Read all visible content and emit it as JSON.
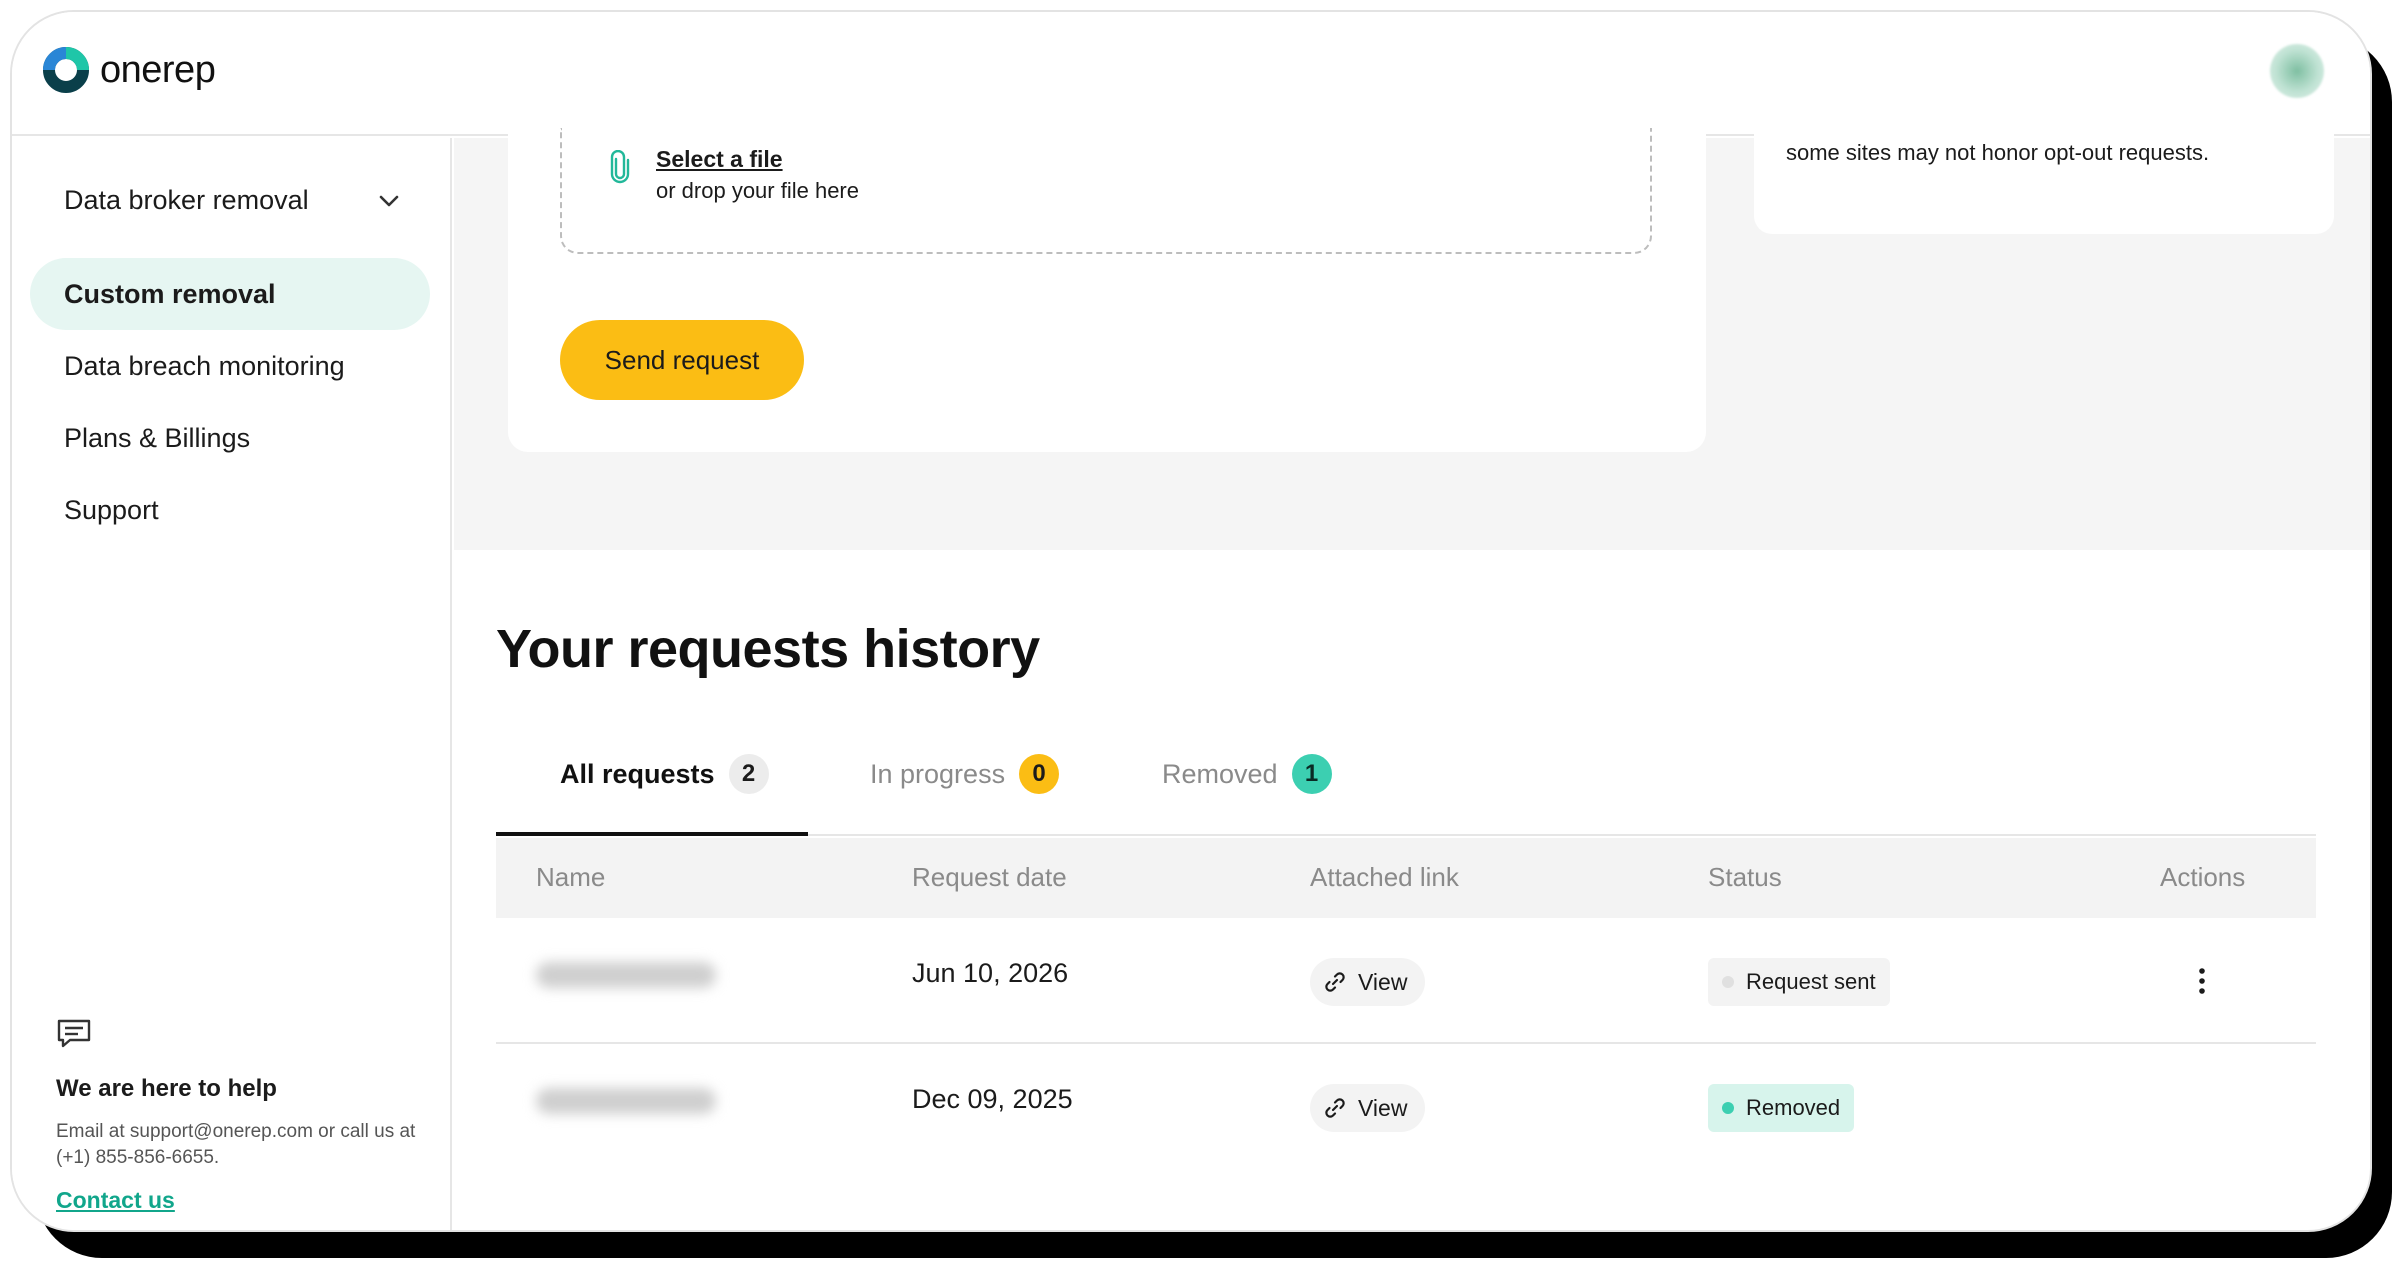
{
  "app": {
    "name": "onerep"
  },
  "colors": {
    "brand_teal": "#11a68b",
    "accent_yellow": "#fbbd14",
    "active_nav_bg": "#e6f6f2"
  },
  "sidebar": {
    "items": [
      {
        "label": "Data broker removal",
        "has_chevron": true
      },
      {
        "label": "Custom removal",
        "active": true
      },
      {
        "label": "Data breach monitoring"
      },
      {
        "label": "Plans & Billings"
      },
      {
        "label": "Support"
      }
    ],
    "help": {
      "title": "We are here to help",
      "text": "Email at support@onerep.com or call us at (+1) 855-856-6655.",
      "link": "Contact us"
    }
  },
  "form": {
    "select_file": "Select a file",
    "drop_text": "or drop your file here",
    "send_button": "Send request"
  },
  "info": {
    "text": "some sites may not honor opt-out requests."
  },
  "history": {
    "title": "Your requests history",
    "tabs": [
      {
        "label": "All requests",
        "count": "2",
        "active": true
      },
      {
        "label": "In progress",
        "count": "0"
      },
      {
        "label": "Removed",
        "count": "1"
      }
    ],
    "columns": [
      "Name",
      "Request date",
      "Attached link",
      "Status",
      "Actions"
    ],
    "rows": [
      {
        "date": "Jun 10, 2026",
        "link": "View",
        "status": "Request sent"
      },
      {
        "date": "Dec 09, 2025",
        "link": "View",
        "status": "Removed"
      }
    ]
  }
}
